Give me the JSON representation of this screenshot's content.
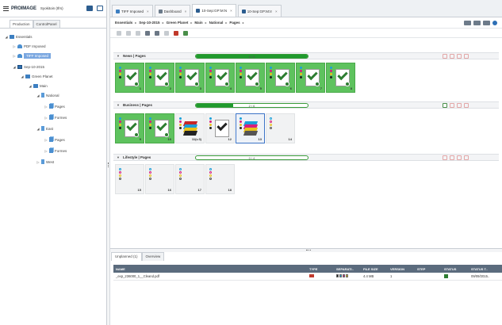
{
  "app": {
    "brand": "PROIMAGE",
    "user": "Syokitoin (Ifrs)"
  },
  "left_tabs": [
    "Production",
    "ControlPanel"
  ],
  "tree": [
    {
      "label": "Essentials",
      "icon": "folder-icon",
      "twisty": "◢",
      "level": 0
    },
    {
      "label": "PDF Imposed",
      "icon": "imposed-icon",
      "twisty": "▷",
      "level": 1
    },
    {
      "label": "TIFF Imposed",
      "icon": "imposed-icon",
      "twisty": "▷",
      "level": 1,
      "selected": true
    },
    {
      "label": "Sep-10-2015",
      "icon": "calendar-icon",
      "twisty": "◢",
      "level": 1
    },
    {
      "label": "Green Planet",
      "icon": "folder-icon",
      "twisty": "◢",
      "level": 2
    },
    {
      "label": "Main",
      "icon": "folder-icon",
      "twisty": "◢",
      "level": 3
    },
    {
      "label": "National",
      "icon": "doc-icon",
      "twisty": "◢",
      "level": 4
    },
    {
      "label": "Pages",
      "icon": "pages-icon",
      "twisty": "▷",
      "level": 5
    },
    {
      "label": "Formes",
      "icon": "pages-icon",
      "twisty": "▷",
      "level": 5
    },
    {
      "label": "East",
      "icon": "doc-icon",
      "twisty": "◢",
      "level": 4
    },
    {
      "label": "Pages",
      "icon": "pages-icon",
      "twisty": "▷",
      "level": 5
    },
    {
      "label": "Formes",
      "icon": "pages-icon",
      "twisty": "▷",
      "level": 5
    },
    {
      "label": "West",
      "icon": "doc-icon",
      "twisty": "▷",
      "level": 4
    }
  ],
  "doc_tabs": [
    {
      "label": "TIFF Imposed",
      "icon": "imposed-icon"
    },
    {
      "label": "Dashboard",
      "icon": "dashboard-icon"
    },
    {
      "label": "10-Sep:GP:M:N",
      "icon": "grid-icon",
      "active": true
    },
    {
      "label": "10-Sep:GP:M:Ir",
      "icon": "grid-icon"
    }
  ],
  "breadcrumb": [
    "Essentials",
    "Sep-10-2015",
    "Green Planet",
    "Main",
    "National",
    "Pages"
  ],
  "sections": [
    {
      "title": "News | Pages",
      "progress_text": "8 / 8",
      "progress": 1.0,
      "pages": [
        {
          "num": "1",
          "state": "green"
        },
        {
          "num": "2",
          "state": "green"
        },
        {
          "num": "3",
          "state": "green"
        },
        {
          "num": "4",
          "state": "green"
        },
        {
          "num": "5",
          "state": "green"
        },
        {
          "num": "6",
          "state": "green"
        },
        {
          "num": "7",
          "state": "green"
        },
        {
          "num": "8",
          "state": "green"
        }
      ]
    },
    {
      "title": "Business | Pages",
      "progress_text": "2 / 6",
      "progress": 0.33,
      "pages": [
        {
          "num": "9",
          "state": "green"
        },
        {
          "num": "10",
          "state": "green"
        },
        {
          "num": "11(v.3)",
          "state": "stack-red"
        },
        {
          "num": "12",
          "state": "tick-black"
        },
        {
          "num": "13",
          "state": "stack-blue",
          "selected": true
        },
        {
          "num": "14",
          "state": "empty"
        }
      ]
    },
    {
      "title": "Lifestyle | Pages",
      "progress_text": "0 / 4",
      "progress": 0.0,
      "pages": [
        {
          "num": "15",
          "state": "empty"
        },
        {
          "num": "16",
          "state": "empty"
        },
        {
          "num": "17",
          "state": "empty"
        },
        {
          "num": "18",
          "state": "empty"
        }
      ]
    }
  ],
  "bottom_tabs": [
    "Unplanned (1)",
    "Overview"
  ],
  "table": {
    "columns": [
      "NAME",
      "TYPE",
      "SEPARATI..",
      "FILE SIZE",
      "VERSION",
      "STEP",
      "STATUS",
      "STATUS T.."
    ],
    "rows": [
      {
        "name": "_exp_236000_1__Cleand.pdf",
        "type": "pdf-icon",
        "separations": "cmyk-icon",
        "size": "4.4 MB",
        "version": "1",
        "step": "",
        "status": "ok-icon",
        "status_time": "09/09/2015.."
      }
    ]
  },
  "colors": {
    "accent": "#2c5d8f",
    "ok": "#1f9a2e",
    "page_done": "#5ec25e",
    "header": "#5b6b7d"
  }
}
